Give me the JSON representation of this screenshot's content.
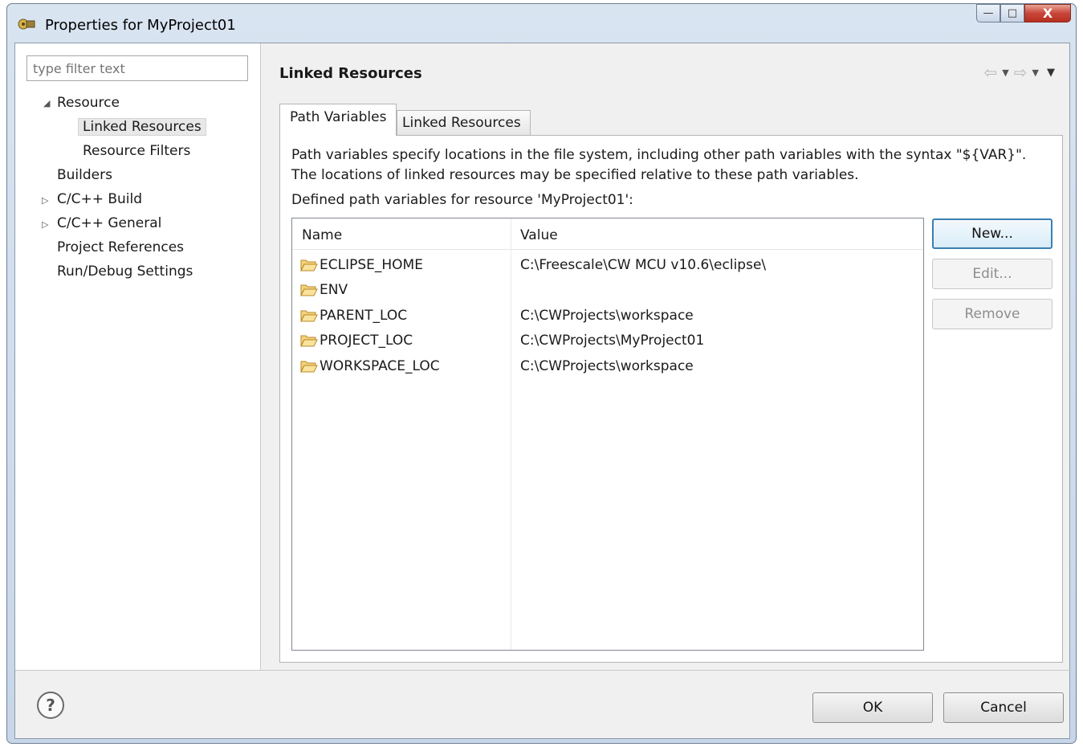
{
  "window": {
    "title": "Properties for MyProject01",
    "minimize": "—",
    "maximize": "□",
    "close": "X"
  },
  "filter": {
    "placeholder": "type filter text"
  },
  "tree": {
    "items": [
      {
        "label": "Resource",
        "twisty": "◢"
      },
      {
        "label": "Linked Resources",
        "selected": true
      },
      {
        "label": "Resource Filters"
      },
      {
        "label": "Builders"
      },
      {
        "label": "C/C++ Build",
        "twisty": "▷"
      },
      {
        "label": "C/C++ General",
        "twisty": "▷"
      },
      {
        "label": "Project References"
      },
      {
        "label": "Run/Debug Settings"
      }
    ]
  },
  "page": {
    "title": "Linked Resources",
    "back_arrow": "⇦",
    "forward_arrow": "⇨",
    "dropdown": "▼"
  },
  "tabs": {
    "path_variables": "Path Variables",
    "linked_resources": "Linked Resources"
  },
  "content": {
    "description_line1": "Path variables specify locations in the file system, including other path variables with the syntax \"${VAR}\".",
    "description_line2": "The locations of linked resources may be specified relative to these path variables.",
    "defined_label": "Defined path variables for resource 'MyProject01':"
  },
  "table": {
    "columns": [
      "Name",
      "Value"
    ],
    "rows": [
      {
        "name": "ECLIPSE_HOME",
        "value": "C:\\Freescale\\CW MCU v10.6\\eclipse\\"
      },
      {
        "name": "ENV",
        "value": ""
      },
      {
        "name": "PARENT_LOC",
        "value": "C:\\CWProjects\\workspace"
      },
      {
        "name": "PROJECT_LOC",
        "value": "C:\\CWProjects\\MyProject01"
      },
      {
        "name": "WORKSPACE_LOC",
        "value": "C:\\CWProjects\\workspace"
      }
    ]
  },
  "buttons": {
    "new": "New...",
    "edit": "Edit...",
    "remove": "Remove",
    "ok": "OK",
    "cancel": "Cancel",
    "help": "?"
  }
}
